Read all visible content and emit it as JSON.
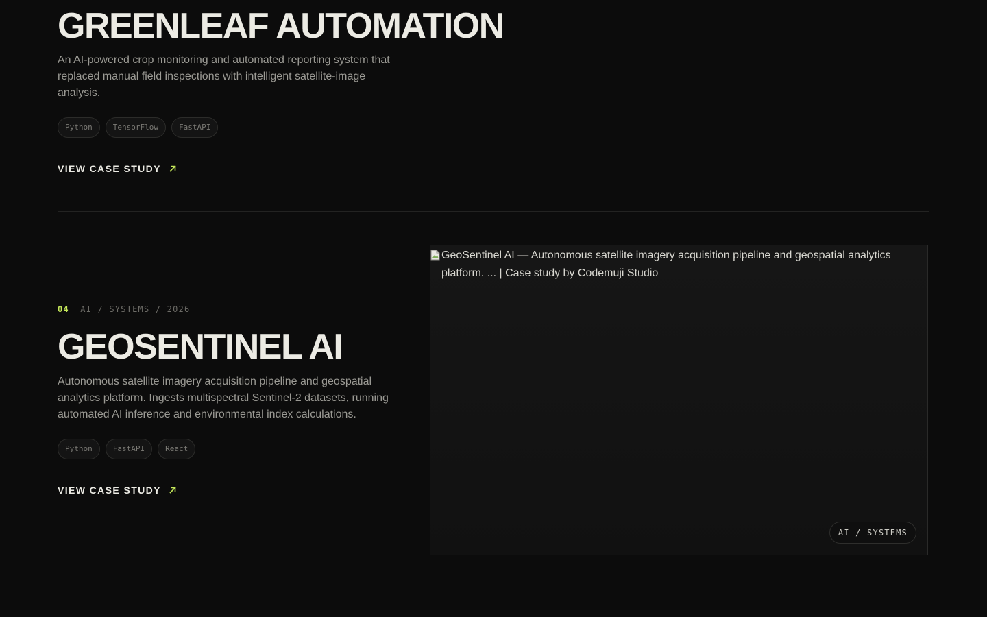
{
  "projects": [
    {
      "title": "GREENLEAF AUTOMATION",
      "description": "An AI-powered crop monitoring and automated reporting system that replaced manual field inspections with intelligent satellite-image analysis.",
      "tags": [
        "Python",
        "TensorFlow",
        "FastAPI"
      ],
      "cta_label": "VIEW CASE STUDY",
      "cta_icon": "arrow-up-right-icon"
    },
    {
      "number": "04",
      "meta": "AI / SYSTEMS / 2026",
      "title": "GEOSENTINEL AI",
      "description": "Autonomous satellite imagery acquisition pipeline and geospatial analytics platform. Ingests multispectral Sentinel-2 datasets, running automated AI inference and environmental index calculations.",
      "tags": [
        "Python",
        "FastAPI",
        "React"
      ],
      "cta_label": "VIEW CASE STUDY",
      "cta_icon": "arrow-up-right-icon",
      "image_alt": "GeoSentinel AI — Autonomous satellite imagery acquisition pipeline and geospatial analytics platform. ... | Case study by Codemuji Studio",
      "image_badge": "AI / SYSTEMS"
    }
  ],
  "colors": {
    "background": "#0c0c0c",
    "text": "#ecebe4",
    "muted": "#9b9a94",
    "accent": "#c5e85a"
  }
}
